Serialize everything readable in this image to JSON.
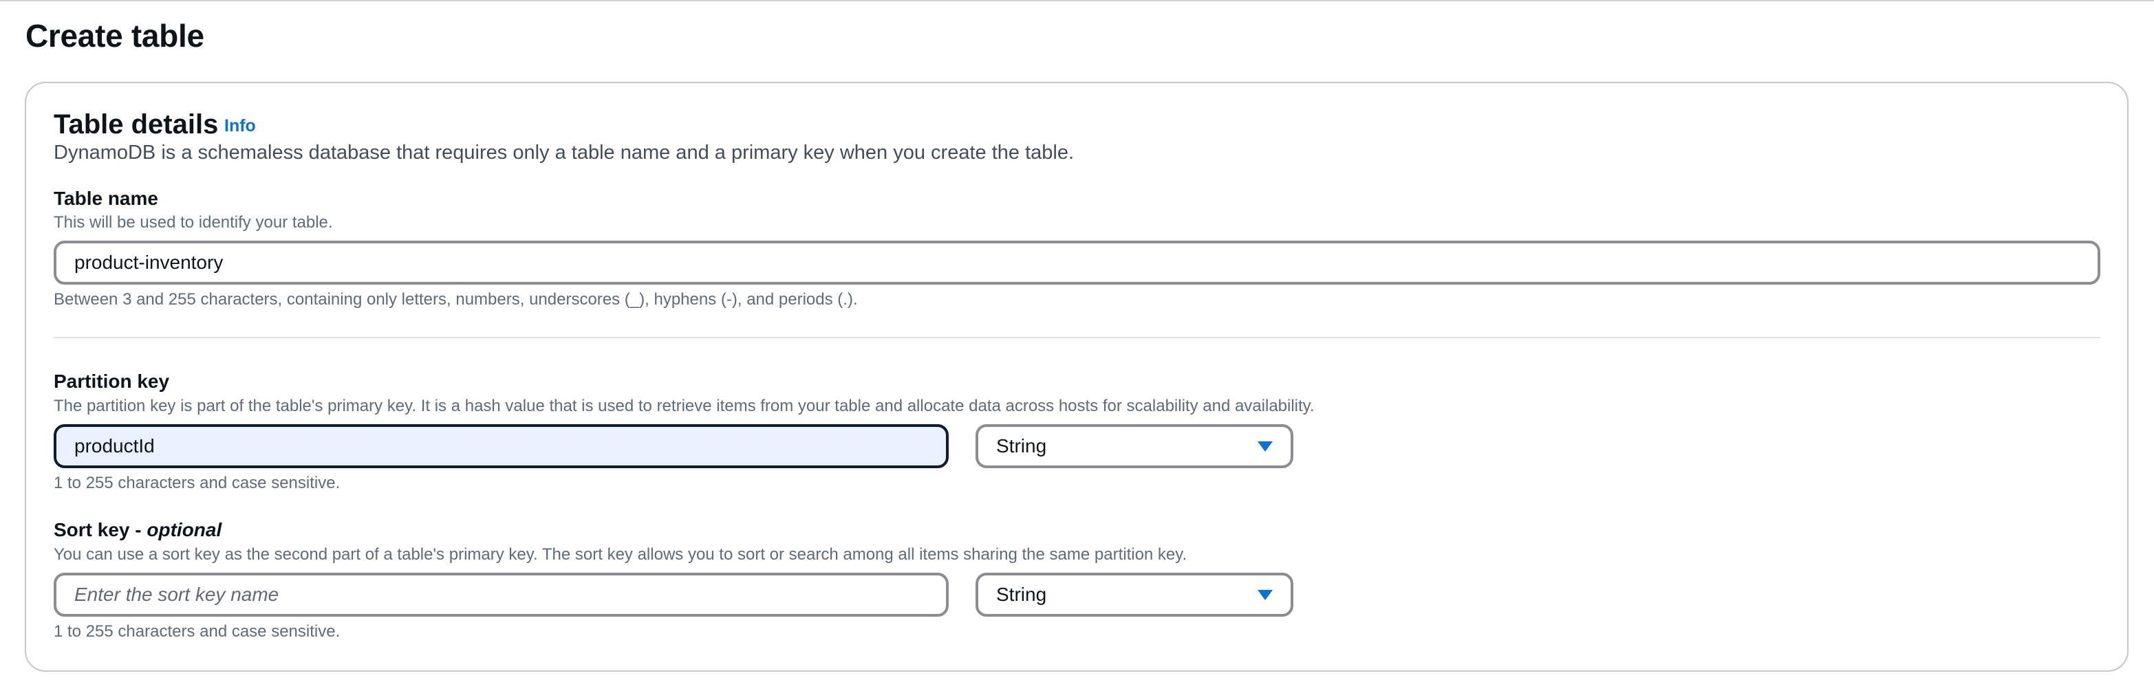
{
  "page": {
    "title": "Create table"
  },
  "panel": {
    "title": "Table details",
    "info_link": "Info",
    "description": "DynamoDB is a schemaless database that requires only a table name and a primary key when you create the table."
  },
  "table_name": {
    "label": "Table name",
    "description": "This will be used to identify your table.",
    "value": "product-inventory",
    "constraint": "Between 3 and 255 characters, containing only letters, numbers, underscores (_), hyphens (-), and periods (.)."
  },
  "partition_key": {
    "label": "Partition key",
    "description": "The partition key is part of the table's primary key. It is a hash value that is used to retrieve items from your table and allocate data across hosts for scalability and availability.",
    "value": "productId",
    "type_selected": "String",
    "constraint": "1 to 255 characters and case sensitive."
  },
  "sort_key": {
    "label": "Sort key - ",
    "label_optional": "optional",
    "description": "You can use a sort key as the second part of a table's primary key. The sort key allows you to sort or search among all items sharing the same partition key.",
    "value": "",
    "placeholder": "Enter the sort key name",
    "type_selected": "String",
    "constraint": "1 to 255 characters and case sensitive."
  },
  "colors": {
    "accent": "#0972d3",
    "focus_border": "#0f1b2e",
    "focus_fill": "#e8f1fd",
    "input_border": "#8c8c94"
  },
  "icons": {
    "dropdown": "caret-down-icon"
  }
}
